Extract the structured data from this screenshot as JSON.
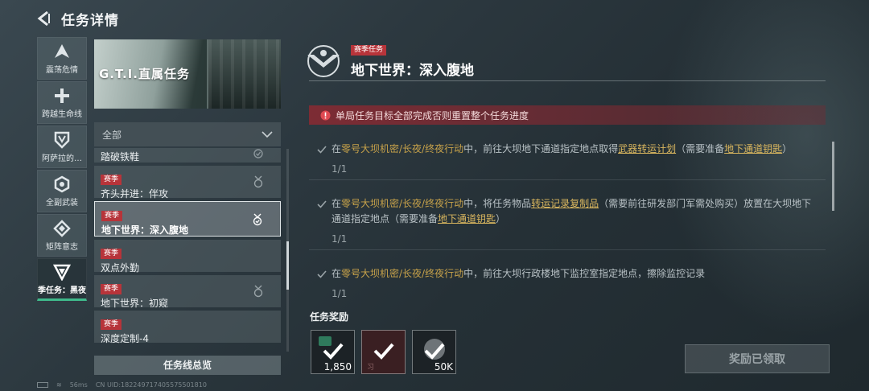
{
  "header": {
    "title": "任务详情"
  },
  "nav": [
    {
      "label": "震荡危情",
      "icon": "alert-a-icon"
    },
    {
      "label": "跨越生命线",
      "icon": "plus-icon"
    },
    {
      "label": "阿萨拉的…",
      "icon": "shield-v-icon"
    },
    {
      "label": "全副武装",
      "icon": "hex-gear-icon"
    },
    {
      "label": "矩阵意志",
      "icon": "diamond-icon"
    },
    {
      "label": "季任务：黑夜",
      "icon": "triangle-badge-icon",
      "active": true
    }
  ],
  "banner": {
    "title": "G.T.I.直属任务"
  },
  "filter": {
    "selected": "全部"
  },
  "tasks": [
    {
      "name": "踏破铁鞋"
    },
    {
      "tag": "赛季",
      "name": "齐头并进：伴攻"
    },
    {
      "tag": "赛季",
      "name": "地下世界：深入腹地",
      "active": true
    },
    {
      "tag": "赛季",
      "name": "双点外勤"
    },
    {
      "tag": "赛季",
      "name": "地下世界：初窥"
    },
    {
      "tag": "赛季",
      "name": "深度定制-4"
    }
  ],
  "summary_button": "任务线总览",
  "detail": {
    "tag": "赛季任务",
    "title": "地下世界：深入腹地",
    "warning": "单局任务目标全部完成否则重置整个任务进度",
    "objectives": [
      {
        "p1": "在",
        "map": "零号大坝机密/长夜/终夜行动",
        "p2": "中，前往大坝地下通道指定地点取得",
        "item": "武器转运计划",
        "p3": "（需要准备",
        "key": "地下通道钥匙",
        "p4": "）",
        "progress": "1/1"
      },
      {
        "p1": "在",
        "map": "零号大坝机密/长夜/终夜行动",
        "p2": "中，将任务物品",
        "item": "转运记录复制品",
        "p3": "（需要前往研发部门军需处购买）放置在大坝地下通道指定地点（需要准备",
        "key": "地下通道钥匙",
        "p4": "）",
        "progress": "1/1"
      },
      {
        "p1": "在",
        "map": "零号大坝机密/长夜/终夜行动",
        "p2": "中，前往大坝行政楼地下监控室指定地点，擦除监控记录",
        "progress": "1/1"
      }
    ]
  },
  "rewards": {
    "label": "任务奖励",
    "items": [
      {
        "count": "1,850",
        "bg": "#1c2226"
      },
      {
        "count": "",
        "sub": "习",
        "bg": "#3a1f22"
      },
      {
        "count": "50K",
        "bg": "#1c2226"
      }
    ]
  },
  "claim_button": "奖励已领取",
  "status": {
    "ping": "56ms",
    "uid": "CN UID:182249717405575501810"
  },
  "colors": {
    "accent_green": "#3fb98a",
    "tag_red": "#b7343a",
    "highlight": "#c7a24a"
  }
}
